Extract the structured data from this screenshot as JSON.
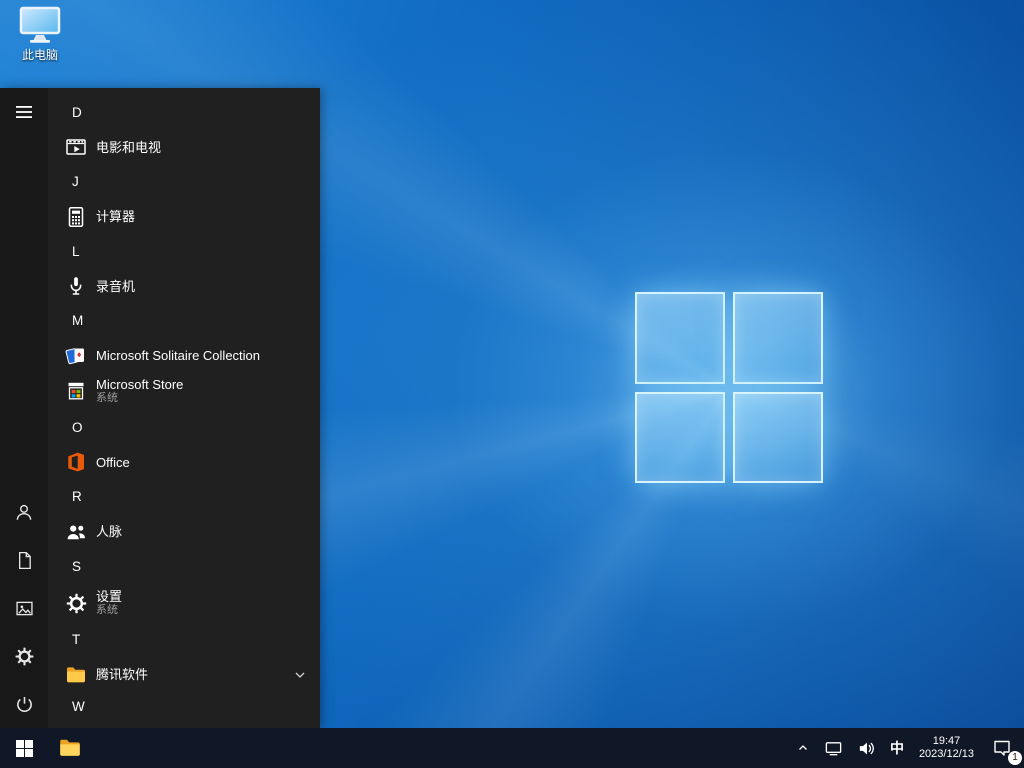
{
  "colors": {
    "accent_blue": "#0078d7",
    "wallpaper_blue": "#1371c7",
    "start_menu_bg": "#202020",
    "taskbar_bg": "#101726",
    "folder_yellow": "#ffc94a",
    "office_orange": "#e8590c",
    "store_red": "#f25022",
    "store_green": "#7fba00",
    "store_blue": "#00a4ef",
    "store_yellow": "#ffb900"
  },
  "desktop": {
    "icons": [
      {
        "label": "此电脑"
      }
    ]
  },
  "start_menu": {
    "items": [
      {
        "type": "section",
        "label": "D"
      },
      {
        "type": "app",
        "label": "电影和电视",
        "icon": "movies-tv-icon"
      },
      {
        "type": "section",
        "label": "J"
      },
      {
        "type": "app",
        "label": "计算器",
        "icon": "calculator-icon"
      },
      {
        "type": "section",
        "label": "L"
      },
      {
        "type": "app",
        "label": "录音机",
        "icon": "voice-recorder-icon"
      },
      {
        "type": "section",
        "label": "M"
      },
      {
        "type": "app",
        "label": "Microsoft Solitaire Collection",
        "icon": "solitaire-icon"
      },
      {
        "type": "app",
        "label": "Microsoft Store",
        "subtitle": "系统",
        "icon": "store-icon"
      },
      {
        "type": "section",
        "label": "O"
      },
      {
        "type": "app",
        "label": "Office",
        "icon": "office-icon"
      },
      {
        "type": "section",
        "label": "R"
      },
      {
        "type": "app",
        "label": "人脉",
        "icon": "people-icon"
      },
      {
        "type": "section",
        "label": "S"
      },
      {
        "type": "app",
        "label": "设置",
        "subtitle": "系统",
        "icon": "settings-gear-icon"
      },
      {
        "type": "section",
        "label": "T"
      },
      {
        "type": "app",
        "label": "腾讯软件",
        "icon": "folder-icon",
        "expandable": true
      },
      {
        "type": "section",
        "label": "W"
      }
    ]
  },
  "taskbar": {
    "tray": {
      "ime": "中",
      "time": "19:47",
      "date": "2023/12/13",
      "badge": "1"
    }
  }
}
